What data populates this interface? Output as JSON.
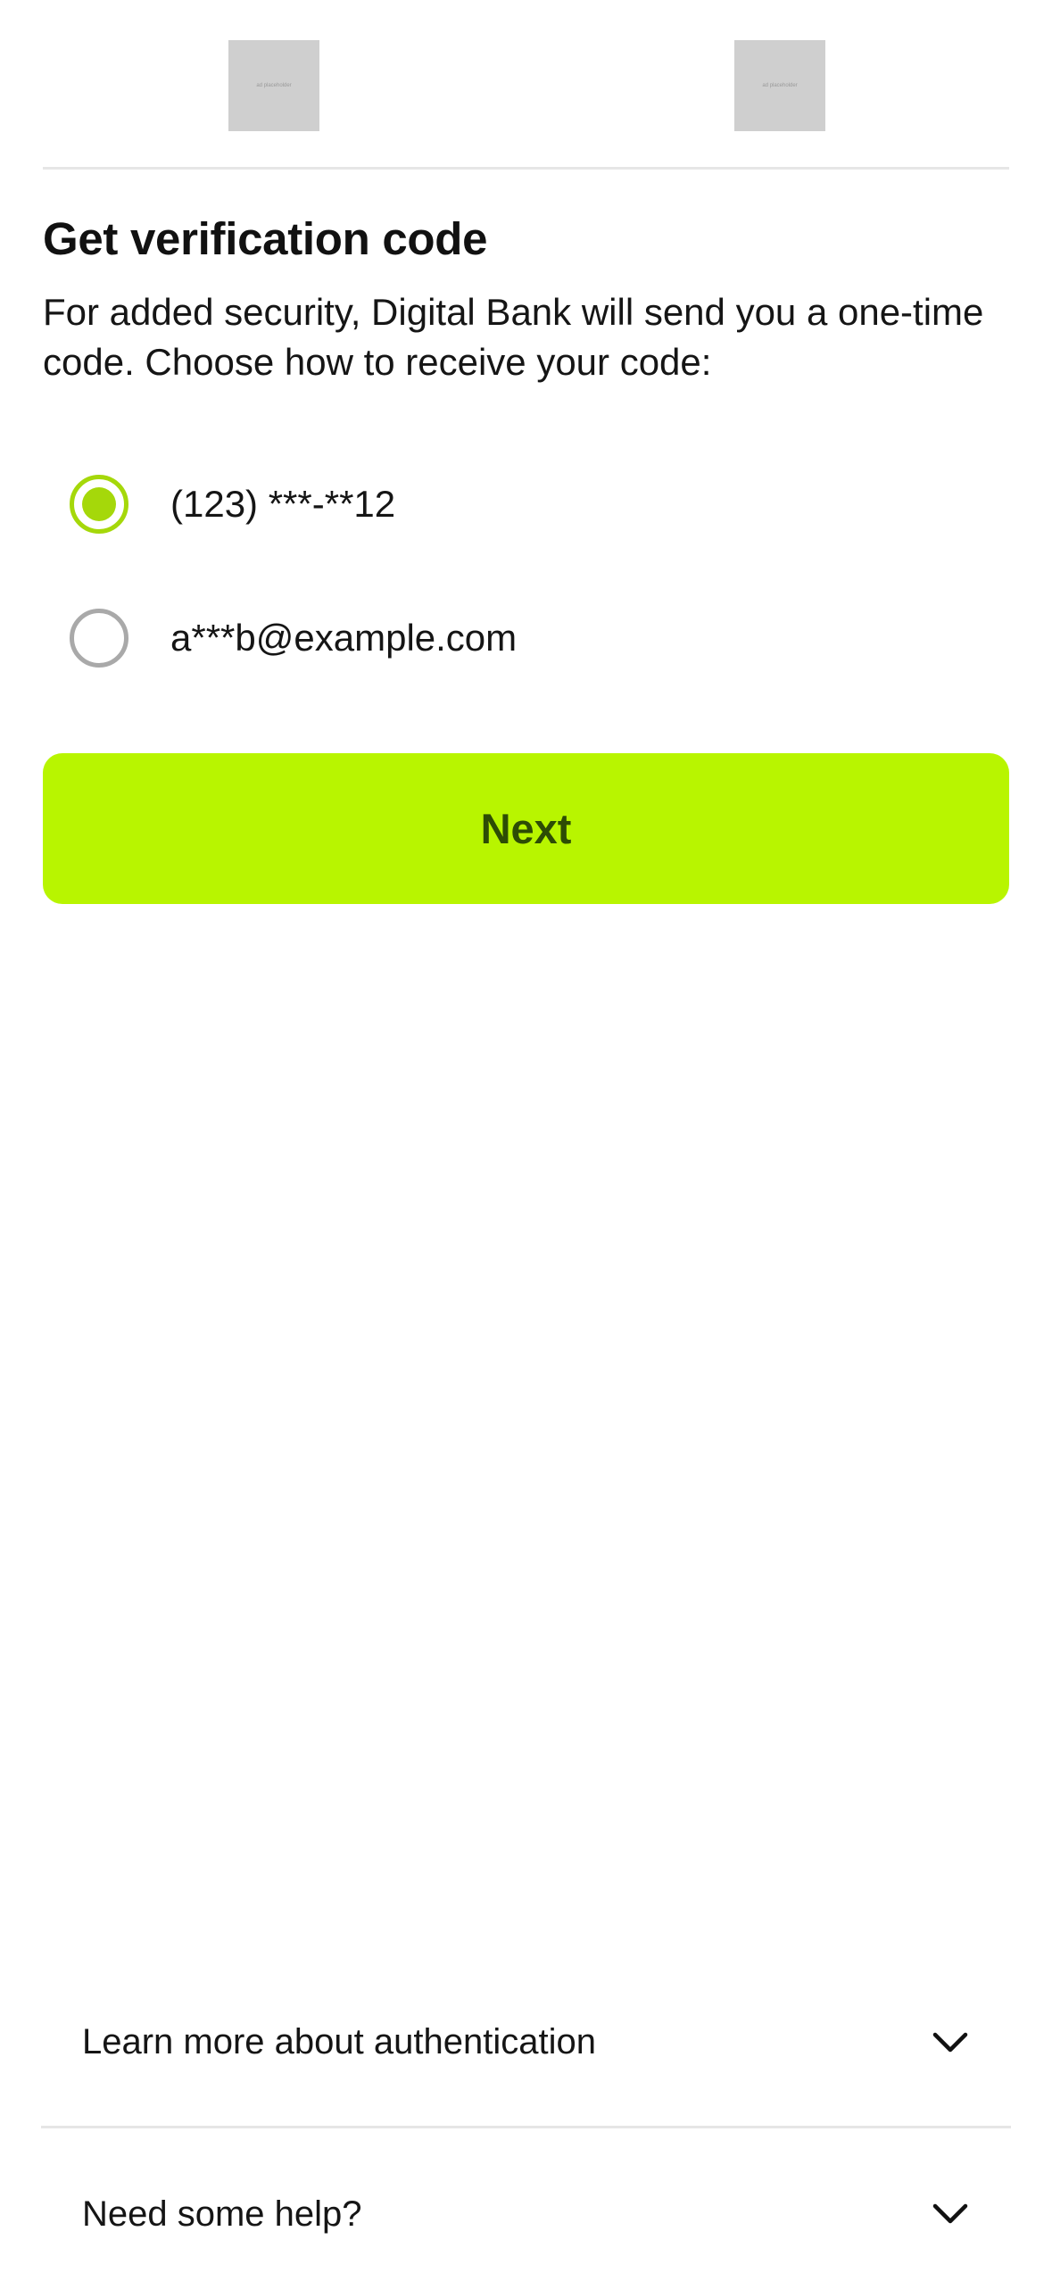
{
  "header": {
    "left_image_caption": "ad placeholder",
    "right_image_caption": "ad placeholder"
  },
  "title": "Get verification code",
  "description": "For added security, Digital Bank will send you a one-time code. Choose how to receive your code:",
  "options": [
    {
      "label": "(123) ***-**12",
      "selected": true
    },
    {
      "label": "a***b@example.com",
      "selected": false
    }
  ],
  "next_button": "Next",
  "accordions": [
    {
      "label": "Learn more about authentication",
      "icon": "chevron-down-icon"
    },
    {
      "label": "Need some help?",
      "icon": "chevron-down-icon"
    }
  ],
  "colors": {
    "accent": "#b8f500",
    "radio_selected": "#a5d80a",
    "button_text": "#2d4c05"
  }
}
